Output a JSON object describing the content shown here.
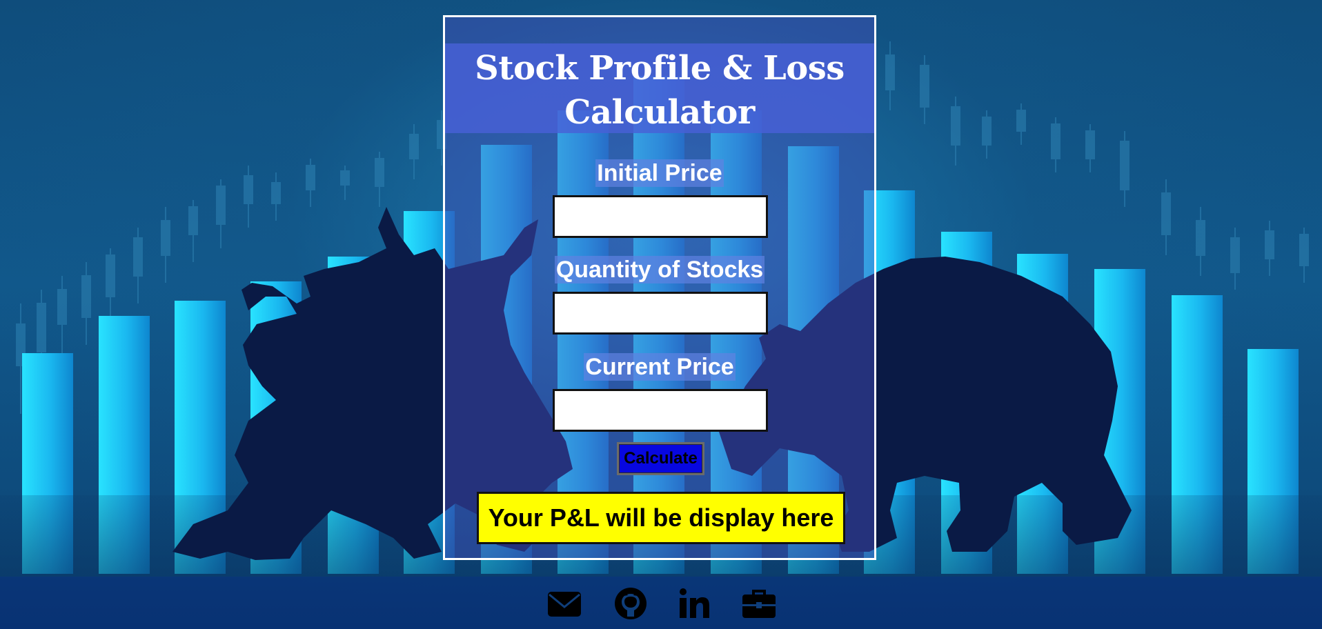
{
  "app": {
    "title": "Stock Profile & Loss Calculator"
  },
  "form": {
    "initial_price_label": "Initial Price",
    "initial_price_value": "",
    "quantity_label": "Quantity of Stocks",
    "quantity_value": "",
    "current_price_label": "Current Price",
    "current_price_value": "",
    "calculate_label": "Calculate"
  },
  "output": {
    "message": "Your P&L will be display here"
  },
  "footer": {
    "links": [
      {
        "icon": "envelope-icon"
      },
      {
        "icon": "github-icon"
      },
      {
        "icon": "linkedin-icon"
      },
      {
        "icon": "briefcase-icon"
      }
    ]
  },
  "colors": {
    "card_border": "#ffffff",
    "title_band": "#4860d7",
    "button": "#0707e0",
    "output_bg": "#ffff00",
    "icon_color": "#000000"
  }
}
